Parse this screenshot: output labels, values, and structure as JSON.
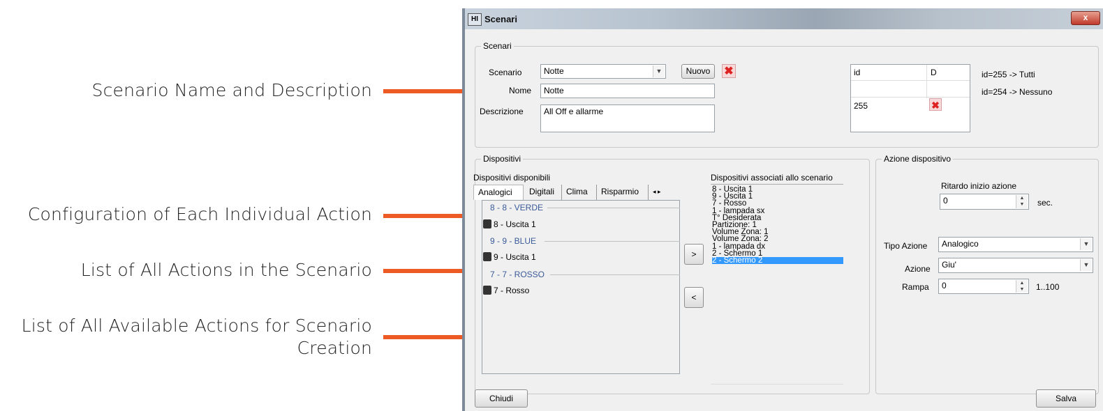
{
  "annotations": [
    "Scenario Name and Description",
    "Configuration of Each Individual Action",
    "List of All Actions in the Scenario",
    "List of All Available Actions for Scenario Creation"
  ],
  "accent": "#ee5a24",
  "window": {
    "title": "Scenari",
    "close": "x",
    "icon": "HI"
  },
  "scenari": {
    "legend": "Scenari",
    "scenario_label": "Scenario",
    "scenario_value": "Notte",
    "new_button": "Nuovo",
    "nome_label": "Nome",
    "nome_value": "Notte",
    "descr_label": "Descrizione",
    "descr_value": "All Off e allarme",
    "table_headers": [
      "id",
      "D"
    ],
    "table_rows": [
      "255"
    ],
    "notes": [
      "id=255 -> Tutti",
      "id=254 -> Nessuno"
    ]
  },
  "dispositivi": {
    "legend": "Dispositivi",
    "available_label": "Dispositivi disponibili",
    "tabs": [
      "Analogici",
      "Digitali",
      "Clima",
      "Risparmio"
    ],
    "groups": [
      {
        "header": "8 - 8 - VERDE",
        "device": "8 - Uscita 1"
      },
      {
        "header": "9 - 9 - BLUE",
        "device": "9 - Uscita 1"
      },
      {
        "header": "7 - 7 - ROSSO",
        "device": "7 - Rosso"
      }
    ],
    "add_button": ">",
    "remove_button": "<",
    "assoc_label": "Dispositivi associati allo scenario",
    "assoc_items": [
      "8 - Uscita 1",
      "9 - Uscita 1",
      "7 - Rosso",
      "1 - lampada sx",
      "T° Desiderata",
      "Partizione: 1",
      "Volume Zona: 1",
      "Volume Zona: 2",
      "1 - lampada dx",
      "2 - Schermo 1",
      "2 - Schermo 2"
    ],
    "selected_index": 10
  },
  "azione": {
    "legend": "Azione dispositivo",
    "delay_label": "Ritardo inizio azione",
    "delay_value": "0",
    "delay_unit": "sec.",
    "tipo_label": "Tipo Azione",
    "tipo_value": "Analogico",
    "azione_label": "Azione",
    "azione_value": "Giu'",
    "rampa_label": "Rampa",
    "rampa_value": "0",
    "rampa_range": "1..100"
  },
  "footer": {
    "close_button": "Chiudi",
    "save_button": "Salva"
  }
}
